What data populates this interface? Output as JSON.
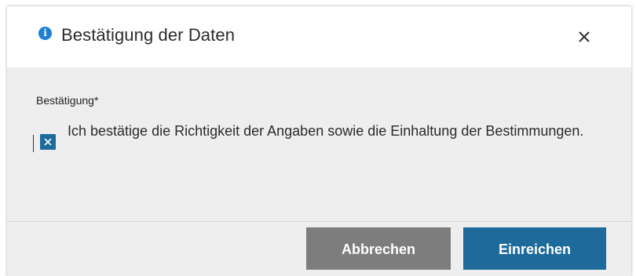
{
  "dialog": {
    "title": "Bestätigung der Daten",
    "info_icon": "info-icon",
    "close_icon": "close-icon"
  },
  "form": {
    "field_label": "Bestätigung*",
    "checkbox": {
      "checked": true,
      "label": "Ich bestätige die Richtigkeit der Angaben sowie die Einhaltung der Bestimmungen."
    }
  },
  "footer": {
    "cancel_label": "Abbrechen",
    "submit_label": "Einreichen"
  },
  "colors": {
    "primary": "#1d6a9b",
    "secondary": "#7d7d7d",
    "info": "#1c7ed6",
    "body_bg": "#eeeeee"
  }
}
